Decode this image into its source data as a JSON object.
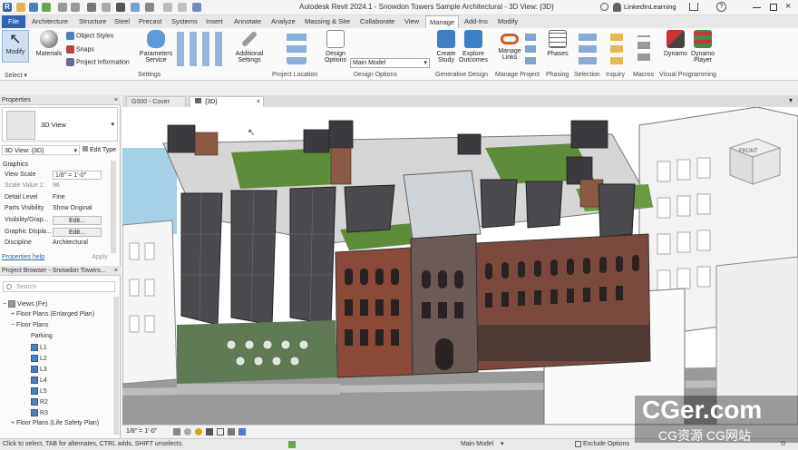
{
  "app": {
    "title": "Autodesk Revit 2024.1 - Snowdon Towers Sample Architectural - 3D View: {3D}",
    "user": "LinkedInLearning"
  },
  "ribbon_tabs": [
    "File",
    "Architecture",
    "Structure",
    "Steel",
    "Precast",
    "Systems",
    "Insert",
    "Annotate",
    "Analyze",
    "Massing & Site",
    "Collaborate",
    "View",
    "Manage",
    "Add-Ins",
    "Modify"
  ],
  "ribbon": {
    "modify": "Modify",
    "select": "Select ▾",
    "materials": "Materials",
    "object_styles": "Object  Styles",
    "snaps": "Snaps",
    "project_information": "Project  Information",
    "parameters_service_1": "Parameters",
    "parameters_service_2": "Service",
    "additional_settings_1": "Additional",
    "additional_settings_2": "Settings",
    "settings_label": "Settings",
    "project_location_label": "Project Location",
    "design_options_1": "Design",
    "design_options_2": "Options",
    "main_model": "Main Model",
    "design_options_label": "Design Options",
    "create_study_1": "Create",
    "create_study_2": "Study",
    "explore_outcomes_1": "Explore",
    "explore_outcomes_2": "Outcomes",
    "generative_design_label": "Generative Design",
    "manage_links_1": "Manage",
    "manage_links_2": "Links",
    "manage_project_label": "Manage Project",
    "phases": "Phases",
    "phasing_label": "Phasing",
    "selection_label": "Selection",
    "inquiry_label": "Inquiry",
    "macros_label": "Macros",
    "dynamo": "Dynamo",
    "dynamo_player_1": "Dynamo",
    "dynamo_player_2": "Player",
    "visual_programming_label": "Visual Programming"
  },
  "properties": {
    "title": "Properties",
    "type_name": "3D View",
    "view_selector": "3D View: {3D}",
    "edit_type": "Edit Type",
    "section_graphics": "Graphics",
    "rows": [
      {
        "k": "View Scale",
        "v": "1/8\" = 1'-0\""
      },
      {
        "k": "Scale Value   1:",
        "v": "96"
      },
      {
        "k": "Detail Level",
        "v": "Fine"
      },
      {
        "k": "Parts Visibility",
        "v": "Show Original"
      },
      {
        "k": "Visibility/Grap...",
        "v": "Edit..."
      },
      {
        "k": "Graphic Displa...",
        "v": "Edit..."
      },
      {
        "k": "Discipline",
        "v": "Architectural"
      }
    ],
    "help": "Properties help",
    "apply": "Apply"
  },
  "browser": {
    "title": "Project Browser - Snowdon Towers...",
    "search": "Search",
    "items": [
      {
        "label": "Views (Fe)",
        "indent": 0
      },
      {
        "label": "Floor Plans (Enlarged Plan)",
        "indent": 1
      },
      {
        "label": "Floor Plans",
        "indent": 1
      },
      {
        "label": "Parking",
        "indent": 2
      },
      {
        "label": "L1",
        "indent": 2
      },
      {
        "label": "L2",
        "indent": 2
      },
      {
        "label": "L3",
        "indent": 2
      },
      {
        "label": "L4",
        "indent": 2
      },
      {
        "label": "L5",
        "indent": 2
      },
      {
        "label": "R2",
        "indent": 2
      },
      {
        "label": "R3",
        "indent": 2
      },
      {
        "label": "Floor Plans (Life Safety Plan)",
        "indent": 1
      }
    ]
  },
  "view_tabs": [
    "G000 - Cover",
    "{3D}"
  ],
  "view_bar": {
    "scale": "1/8\" = 1'-0\""
  },
  "viewcube": "FRONT",
  "status": {
    "hint": "Click to select, TAB for alternates, CTRL adds, SHIFT unselects.",
    "model": "Main Model",
    "exclude": "Exclude Options",
    "zero": ":0"
  },
  "watermark": {
    "main": "CGer.com",
    "sub": "CG资源  CG网站"
  },
  "colors": {
    "accent": "#2f63b5",
    "brick": "#8a4a3a",
    "glass": "#4a4a4f",
    "roof_green": "#5e8c3a",
    "water": "#a5d0e6"
  }
}
